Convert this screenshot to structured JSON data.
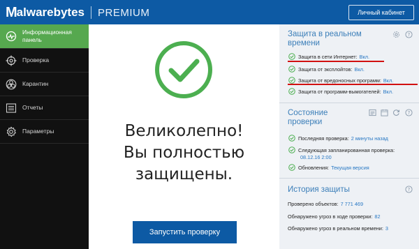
{
  "brand": {
    "logo_m": "M",
    "logo_rest": "alwarebytes",
    "edition": "PREMIUM",
    "account_button": "Личный кабинет"
  },
  "colors": {
    "brand_blue": "#0d5aa4",
    "sidebar_bg": "#111111",
    "active_green": "#56a84f",
    "check_green": "#4caf50",
    "link_blue": "#2878c4",
    "section_title": "#3c7fb9",
    "highlight_red": "#d11010",
    "panel_bg": "#eef1f5"
  },
  "sidebar": {
    "items": [
      {
        "label": "Информационная панель",
        "icon": "dashboard-icon",
        "active": true
      },
      {
        "label": "Проверка",
        "icon": "scan-target-icon",
        "active": false
      },
      {
        "label": "Карантин",
        "icon": "quarantine-biohazard-icon",
        "active": false
      },
      {
        "label": "Отчеты",
        "icon": "reports-list-icon",
        "active": false
      },
      {
        "label": "Параметры",
        "icon": "gear-icon",
        "active": false
      }
    ]
  },
  "main": {
    "status_line1": "Великолепно!",
    "status_line2": "Вы полностью",
    "status_line3": "защищены.",
    "scan_button": "Запустить проверку"
  },
  "realtime": {
    "title_line1": "Защита в реальном",
    "title_line2": "времени",
    "items": [
      {
        "label": "Защита в сети Интернет:",
        "value": "Вкл."
      },
      {
        "label": "Защита от эксплойтов:",
        "value": "Вкл."
      },
      {
        "label": "Защита от вредоносных программ:",
        "value": "Вкл."
      },
      {
        "label": "Защита от программ-вымогателей:",
        "value": "Вкл."
      }
    ]
  },
  "scan_status": {
    "title_line1": "Состояние",
    "title_line2": "проверки",
    "last_scan_label": "Последняя проверка:",
    "last_scan_value": "2 минуты назад",
    "next_scan_label": "Следующая запланированная проверка:",
    "next_scan_value": "08.12.16 2:00",
    "updates_label": "Обновления:",
    "updates_value": "Текущая версия"
  },
  "history": {
    "title": "История защиты",
    "items": [
      {
        "label": "Проверено объектов:",
        "value": "7 771 469"
      },
      {
        "label": "Обнаружено угроз в ходе проверки:",
        "value": "82"
      },
      {
        "label": "Обнаружено угроз в реальном времени:",
        "value": "3"
      }
    ]
  }
}
